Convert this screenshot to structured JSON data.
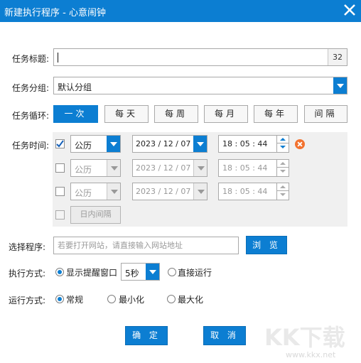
{
  "window": {
    "title": "新建执行程序 - 心意闹钟",
    "close_icon": "close-icon"
  },
  "task_title": {
    "label": "任务标题:",
    "value": "",
    "counter": "32"
  },
  "task_group": {
    "label": "任务分组:",
    "selected": "默认分组"
  },
  "task_cycle": {
    "label": "任务循环:",
    "options": [
      "一次",
      "每天",
      "每周",
      "每月",
      "每年",
      "间隔"
    ],
    "selected": "一次"
  },
  "task_time": {
    "label": "任务时间:",
    "rows": [
      {
        "checked": true,
        "calendar": "公历",
        "date": "2023 / 12 / 07",
        "time": "18 : 05 : 44",
        "enabled": true
      },
      {
        "checked": false,
        "calendar": "公历",
        "date": "2023 / 12 / 07",
        "time": "18 : 05 : 44",
        "enabled": false
      },
      {
        "checked": false,
        "calendar": "公历",
        "date": "2023 / 12 / 07",
        "time": "18 : 05 : 44",
        "enabled": false
      }
    ],
    "interval_button": "日内间隔"
  },
  "select_program": {
    "label": "选择程序:",
    "placeholder": "若要打开网站，请直接输入网站地址",
    "browse_label": "浏 览"
  },
  "exec_mode": {
    "label": "执行方式:",
    "option_popup": "显示提醒窗口",
    "popup_delay": "5秒",
    "option_direct": "直接运行",
    "selected": "popup"
  },
  "run_mode": {
    "label": "运行方式:",
    "options": [
      "常规",
      "最小化",
      "最大化"
    ],
    "selected": "常规"
  },
  "footer": {
    "ok_label": "确 定",
    "cancel_label": "取 消"
  },
  "watermark": {
    "logo_text": "KK下载",
    "url": "www.kkx.net"
  },
  "colors": {
    "accent": "#0c7ed2",
    "remove": "#f2722f"
  }
}
